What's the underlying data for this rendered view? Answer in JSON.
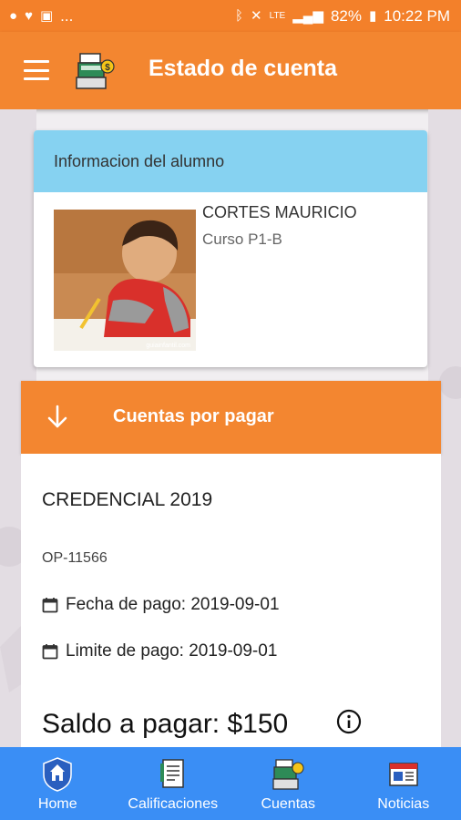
{
  "status_bar": {
    "battery": "82%",
    "time": "10:22 PM",
    "network": "LTE",
    "notif_more": "..."
  },
  "app_bar": {
    "title": "Estado de cuenta"
  },
  "student_card": {
    "header": "Informacion del alumno",
    "name": "CORTES MAURICIO",
    "course": "Curso P1-B",
    "photo_watermark": "guiainfantil.com"
  },
  "accounts": {
    "section_label": "Cuentas por pagar",
    "concept": "CREDENCIAL 2019",
    "reference": "OP-11566",
    "payment_date": "Fecha de pago: 2019-09-01",
    "limit_date": "Limite de pago: 2019-09-01",
    "balance": "Saldo a pagar: $150"
  },
  "bottom_nav": {
    "items": [
      {
        "label": "Home",
        "icon": "shield-home-icon"
      },
      {
        "label": "Calificaciones",
        "icon": "grades-document-icon"
      },
      {
        "label": "Cuentas",
        "icon": "cash-register-icon"
      },
      {
        "label": "Noticias",
        "icon": "newspaper-icon"
      }
    ]
  },
  "colors": {
    "primary_orange": "#f38630",
    "card_header_blue": "#86d2f1",
    "bottom_nav_blue": "#3a8ef5"
  }
}
